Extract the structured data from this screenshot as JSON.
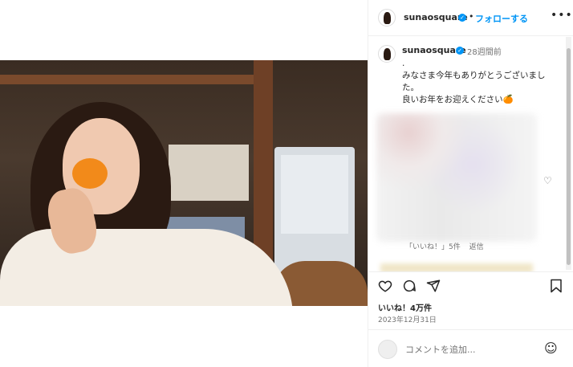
{
  "header": {
    "username": "sunaosquare",
    "separator": "•",
    "follow_label": "フォローする",
    "more_label": "•••"
  },
  "caption": {
    "username": "sunaosquare",
    "time": "28週間前",
    "text": ".\nみなさま今年もありがとうございました。\n良いお年をお迎えください🍊"
  },
  "comment": {
    "likes_text": "「いいね！」5件",
    "reply_label": "返信"
  },
  "actions": {
    "likes_count": "いいね！4万件",
    "date": "2023年12月31日"
  },
  "add_comment": {
    "placeholder": "コメントを追加..."
  },
  "colors": {
    "accent": "#0095f6",
    "text": "#262626",
    "muted": "#737373"
  }
}
